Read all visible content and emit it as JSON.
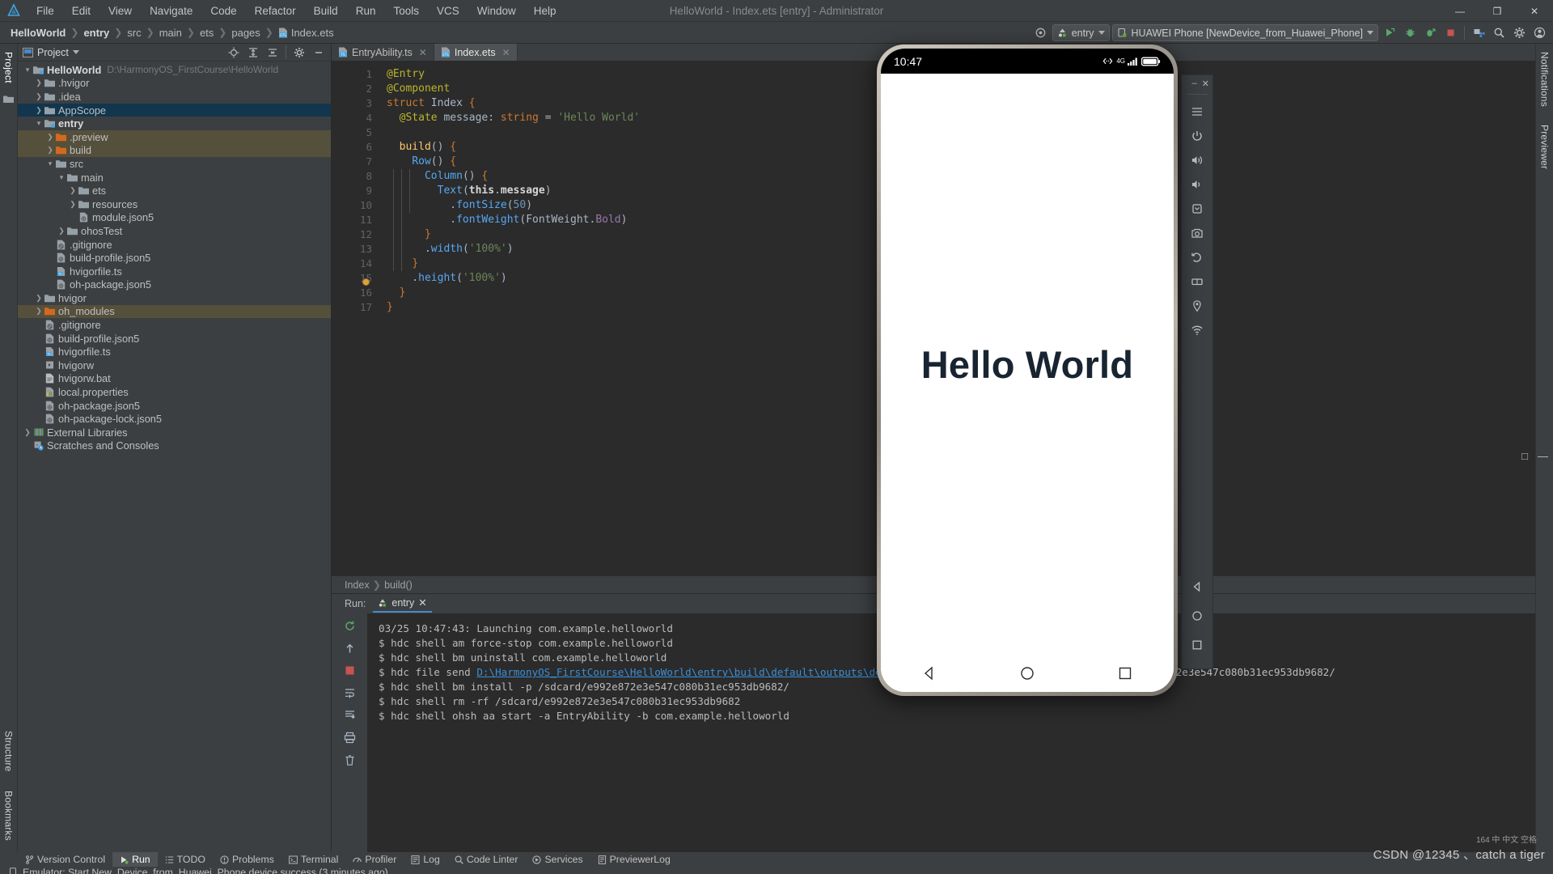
{
  "app": {
    "window_title": "HelloWorld - Index.ets [entry] - Administrator",
    "logo_icon": "deveco-studio-logo-icon"
  },
  "menubar": {
    "items": [
      {
        "label": "File"
      },
      {
        "label": "Edit"
      },
      {
        "label": "View"
      },
      {
        "label": "Navigate"
      },
      {
        "label": "Code"
      },
      {
        "label": "Refactor"
      },
      {
        "label": "Build"
      },
      {
        "label": "Run"
      },
      {
        "label": "Tools"
      },
      {
        "label": "VCS"
      },
      {
        "label": "Window"
      },
      {
        "label": "Help"
      }
    ]
  },
  "window_controls": {
    "minimize": "—",
    "maximize": "❐",
    "close": "✕"
  },
  "navbar": {
    "breadcrumbs": [
      "HelloWorld",
      "entry",
      "src",
      "main",
      "ets",
      "pages",
      "Index.ets"
    ],
    "separator": "❯",
    "settings_icon": "target-settings-icon",
    "run_config": {
      "label": "entry",
      "icon": "module-entry-icon"
    },
    "device": {
      "label": "HUAWEI Phone [NewDevice_from_Huawei_Phone]",
      "icon": "device-phone-icon"
    },
    "actions": [
      {
        "name": "run-button",
        "icon": "run-arrow-icon",
        "color": "#59a869"
      },
      {
        "name": "debug-button",
        "icon": "debug-bug-icon",
        "color": "#59a869"
      },
      {
        "name": "profile-button",
        "icon": "profile-icon",
        "color": "#59a869"
      },
      {
        "name": "stop-button",
        "icon": "stop-square-icon",
        "color": "#c75450"
      },
      {
        "name": "device-manager-button",
        "icon": "device-manager-icon",
        "color": "#6f9dc9"
      },
      {
        "name": "search-button",
        "icon": "search-icon",
        "color": "#b4b4b4"
      },
      {
        "name": "settings-button",
        "icon": "gear-icon",
        "color": "#b4b4b4"
      },
      {
        "name": "account-button",
        "icon": "account-avatar-icon",
        "color": "#b4b4b4"
      }
    ]
  },
  "left_rail": {
    "items": [
      {
        "label": "Project",
        "active": true,
        "icon": "project-panel-icon"
      },
      {
        "label": "",
        "active": false,
        "icon": "folder-icon"
      }
    ],
    "bottom_items": [
      {
        "label": "Structure",
        "icon": "structure-icon"
      },
      {
        "label": "Bookmarks",
        "icon": "bookmarks-icon"
      }
    ]
  },
  "right_rail": {
    "items": [
      {
        "label": "Notifications",
        "icon": "notifications-bell-icon"
      },
      {
        "label": "Previewer",
        "icon": "previewer-icon"
      }
    ]
  },
  "project_panel": {
    "title": "Project",
    "title_icon": "project-dropdown-icon",
    "toolbar": [
      {
        "name": "select-opened-file-button",
        "icon": "locate-target-icon"
      },
      {
        "name": "expand-all-button",
        "icon": "expand-all-icon"
      },
      {
        "name": "collapse-all-button",
        "icon": "collapse-all-icon"
      },
      {
        "name": "panel-options-button",
        "icon": "gear-icon"
      },
      {
        "name": "hide-panel-button",
        "icon": "minimize-icon"
      }
    ],
    "tree": [
      {
        "indent": 0,
        "arrow": "down",
        "icon": "project-root-folder-icon",
        "label": "HelloWorld",
        "bold": true,
        "sub": "D:\\HarmonyOS_FirstCourse\\HelloWorld",
        "state": "none"
      },
      {
        "indent": 1,
        "arrow": "right",
        "icon": "folder-icon",
        "label": ".hvigor",
        "state": "none"
      },
      {
        "indent": 1,
        "arrow": "right",
        "icon": "folder-icon",
        "label": ".idea",
        "state": "none"
      },
      {
        "indent": 1,
        "arrow": "right",
        "icon": "folder-icon",
        "label": "AppScope",
        "state": "selected"
      },
      {
        "indent": 1,
        "arrow": "down",
        "icon": "module-folder-icon",
        "label": "entry",
        "bold": true,
        "state": "none"
      },
      {
        "indent": 2,
        "arrow": "right",
        "icon": "orange-folder-icon",
        "label": ".preview",
        "state": "excluded"
      },
      {
        "indent": 2,
        "arrow": "right",
        "icon": "orange-folder-icon",
        "label": "build",
        "state": "excluded"
      },
      {
        "indent": 2,
        "arrow": "down",
        "icon": "folder-icon",
        "label": "src",
        "state": "none"
      },
      {
        "indent": 3,
        "arrow": "down",
        "icon": "folder-icon",
        "label": "main",
        "state": "none"
      },
      {
        "indent": 4,
        "arrow": "right",
        "icon": "folder-icon",
        "label": "ets",
        "state": "none"
      },
      {
        "indent": 4,
        "arrow": "right",
        "icon": "folder-icon",
        "label": "resources",
        "state": "none"
      },
      {
        "indent": 4,
        "arrow": "none",
        "icon": "json5-file-icon",
        "label": "module.json5",
        "state": "none"
      },
      {
        "indent": 3,
        "arrow": "right",
        "icon": "folder-icon",
        "label": "ohosTest",
        "state": "none"
      },
      {
        "indent": 2,
        "arrow": "none",
        "icon": "gitignore-file-icon",
        "label": ".gitignore",
        "state": "none"
      },
      {
        "indent": 2,
        "arrow": "none",
        "icon": "json5-file-icon",
        "label": "build-profile.json5",
        "state": "none"
      },
      {
        "indent": 2,
        "arrow": "none",
        "icon": "ts-file-icon",
        "label": "hvigorfile.ts",
        "state": "none"
      },
      {
        "indent": 2,
        "arrow": "none",
        "icon": "json5-file-icon",
        "label": "oh-package.json5",
        "state": "none"
      },
      {
        "indent": 1,
        "arrow": "right",
        "icon": "folder-icon",
        "label": "hvigor",
        "state": "none"
      },
      {
        "indent": 1,
        "arrow": "right",
        "icon": "orange-folder-icon",
        "label": "oh_modules",
        "state": "excluded"
      },
      {
        "indent": 1,
        "arrow": "none",
        "icon": "gitignore-file-icon",
        "label": ".gitignore",
        "state": "none"
      },
      {
        "indent": 1,
        "arrow": "none",
        "icon": "json5-file-icon",
        "label": "build-profile.json5",
        "state": "none"
      },
      {
        "indent": 1,
        "arrow": "none",
        "icon": "ts-file-icon",
        "label": "hvigorfile.ts",
        "state": "none"
      },
      {
        "indent": 1,
        "arrow": "none",
        "icon": "script-file-icon",
        "label": "hvigorw",
        "state": "none"
      },
      {
        "indent": 1,
        "arrow": "none",
        "icon": "bat-file-icon",
        "label": "hvigorw.bat",
        "state": "none"
      },
      {
        "indent": 1,
        "arrow": "none",
        "icon": "properties-file-icon",
        "label": "local.properties",
        "state": "none"
      },
      {
        "indent": 1,
        "arrow": "none",
        "icon": "json5-file-icon",
        "label": "oh-package.json5",
        "state": "none"
      },
      {
        "indent": 1,
        "arrow": "none",
        "icon": "json5-file-icon",
        "label": "oh-package-lock.json5",
        "state": "none"
      },
      {
        "indent": 0,
        "arrow": "right",
        "icon": "external-libraries-icon",
        "label": "External Libraries",
        "state": "none"
      },
      {
        "indent": 0,
        "arrow": "none",
        "icon": "scratches-icon",
        "label": "Scratches and Consoles",
        "state": "none"
      }
    ]
  },
  "editor": {
    "tabs": [
      {
        "label": "EntryAbility.ts",
        "icon": "ts-file-icon",
        "active": false,
        "close": "✕"
      },
      {
        "label": "Index.ets",
        "icon": "ets-file-icon",
        "active": true,
        "close": "✕"
      }
    ],
    "line_numbers": [
      "1",
      "2",
      "3",
      "4",
      "5",
      "6",
      "7",
      "8",
      "9",
      "10",
      "11",
      "12",
      "13",
      "14",
      "15",
      "16",
      "17"
    ],
    "lines": [
      "@Entry",
      "@Component",
      "struct Index {",
      "  @State message: string = 'Hello World'",
      "",
      "  build() {",
      "    Row() {",
      "      Column() {",
      "        Text(this.message)",
      "          .fontSize(50)",
      "          .fontWeight(FontWeight.Bold)",
      "      }",
      "      .width('100%')",
      "    }",
      "    .height('100%')",
      "  }",
      "}"
    ],
    "breadcrumb": [
      "Index",
      "build()"
    ],
    "breadcrumb_sep": "❯",
    "warning_marker": "warning-bulb-icon"
  },
  "run_panel": {
    "label": "Run:",
    "tab": {
      "label": "entry",
      "icon": "module-entry-icon",
      "close": "✕"
    },
    "side_actions": [
      {
        "name": "rerun-button",
        "icon": "rerun-icon",
        "color": "#59a869"
      },
      {
        "name": "scroll-up-button",
        "icon": "arrow-up-icon",
        "color": "#a9b7c6"
      },
      {
        "name": "stop-process-button",
        "icon": "stop-square-icon",
        "color": "#c75450"
      },
      {
        "name": "wrap-text-button",
        "icon": "soft-wrap-icon",
        "color": "#a9b7c6"
      },
      {
        "name": "scroll-to-end-button",
        "icon": "scroll-end-icon",
        "color": "#a9b7c6"
      },
      {
        "name": "print-button",
        "icon": "print-icon",
        "color": "#a9b7c6"
      },
      {
        "name": "clear-all-button",
        "icon": "trash-icon",
        "color": "#a9b7c6"
      }
    ],
    "console": {
      "line1": "03/25 10:47:43: Launching com.example.helloworld",
      "line2": "$ hdc shell am force-stop com.example.helloworld",
      "line3": "$ hdc shell bm uninstall com.example.helloworld",
      "line4_prefix": "$ hdc file send ",
      "line4_link": "D:\\HarmonyOS_FirstCourse\\HelloWorld\\entry\\build\\default\\outputs\\default\\entry-default-unsigned.hap",
      "line4_suffix": " /sdcard/e992e872e3e547c080b31ec953db9682/",
      "line5": "$ hdc shell bm install -p /sdcard/e992e872e3e547c080b31ec953db9682/",
      "line6": "$ hdc shell rm -rf /sdcard/e992e872e3e547c080b31ec953db9682",
      "line7": "$ hdc shell ohsh aa start -a EntryAbility -b com.example.helloworld"
    }
  },
  "statusbar": {
    "tabs": [
      {
        "label": "Version Control",
        "icon": "branch-icon",
        "active": false
      },
      {
        "label": "Run",
        "icon": "run-arrow-icon",
        "active": true
      },
      {
        "label": "TODO",
        "icon": "todo-list-icon",
        "active": false
      },
      {
        "label": "Problems",
        "icon": "problems-icon",
        "active": false
      },
      {
        "label": "Terminal",
        "icon": "terminal-icon",
        "active": false
      },
      {
        "label": "Profiler",
        "icon": "profiler-icon",
        "active": false
      },
      {
        "label": "Log",
        "icon": "log-icon",
        "active": false
      },
      {
        "label": "Code Linter",
        "icon": "code-linter-icon",
        "active": false
      },
      {
        "label": "Services",
        "icon": "services-icon",
        "active": false
      },
      {
        "label": "PreviewerLog",
        "icon": "previewer-log-icon",
        "active": false
      }
    ],
    "message": "Emulator: Start New_Device_from_Huawei_Phone device success (3 minutes ago)",
    "message_icon": "emulator-icon"
  },
  "emulator": {
    "status_time": "10:47",
    "status_icons": [
      "network-share-icon",
      "4g-signal-icon",
      "signal-bars-icon",
      "battery-icon"
    ],
    "signal_label": "4G",
    "app_text": "Hello World",
    "nav_buttons": [
      {
        "name": "nav-back-button",
        "icon": "triangle-back-icon"
      },
      {
        "name": "nav-home-button",
        "icon": "circle-home-icon"
      },
      {
        "name": "nav-recents-button",
        "icon": "square-recents-icon"
      }
    ]
  },
  "previewer_strip": {
    "window_controls": [
      {
        "name": "previewer-minimize-button",
        "icon": "minimize-icon",
        "glyph": "–"
      },
      {
        "name": "previewer-close-button",
        "icon": "close-icon",
        "glyph": "✕"
      }
    ],
    "tools": [
      {
        "name": "previewer-menu-button",
        "icon": "hamburger-menu-icon"
      },
      {
        "name": "previewer-power-button",
        "icon": "power-icon"
      },
      {
        "name": "previewer-volume-up-button",
        "icon": "volume-up-icon"
      },
      {
        "name": "previewer-volume-down-button",
        "icon": "volume-down-icon"
      },
      {
        "name": "previewer-rotate-left-button",
        "icon": "rotate-left-icon"
      },
      {
        "name": "previewer-rotate-right-button",
        "icon": "rotate-right-icon"
      },
      {
        "name": "previewer-screenshot-button",
        "icon": "camera-screenshot-icon"
      },
      {
        "name": "previewer-fold-button",
        "icon": "fold-device-icon"
      },
      {
        "name": "previewer-location-button",
        "icon": "location-pin-icon"
      },
      {
        "name": "previewer-wifi-button",
        "icon": "wifi-icon"
      }
    ]
  },
  "watermark": {
    "text": "CSDN @12345 、catch a tiger",
    "small_text": "164  中  中文  空格"
  }
}
